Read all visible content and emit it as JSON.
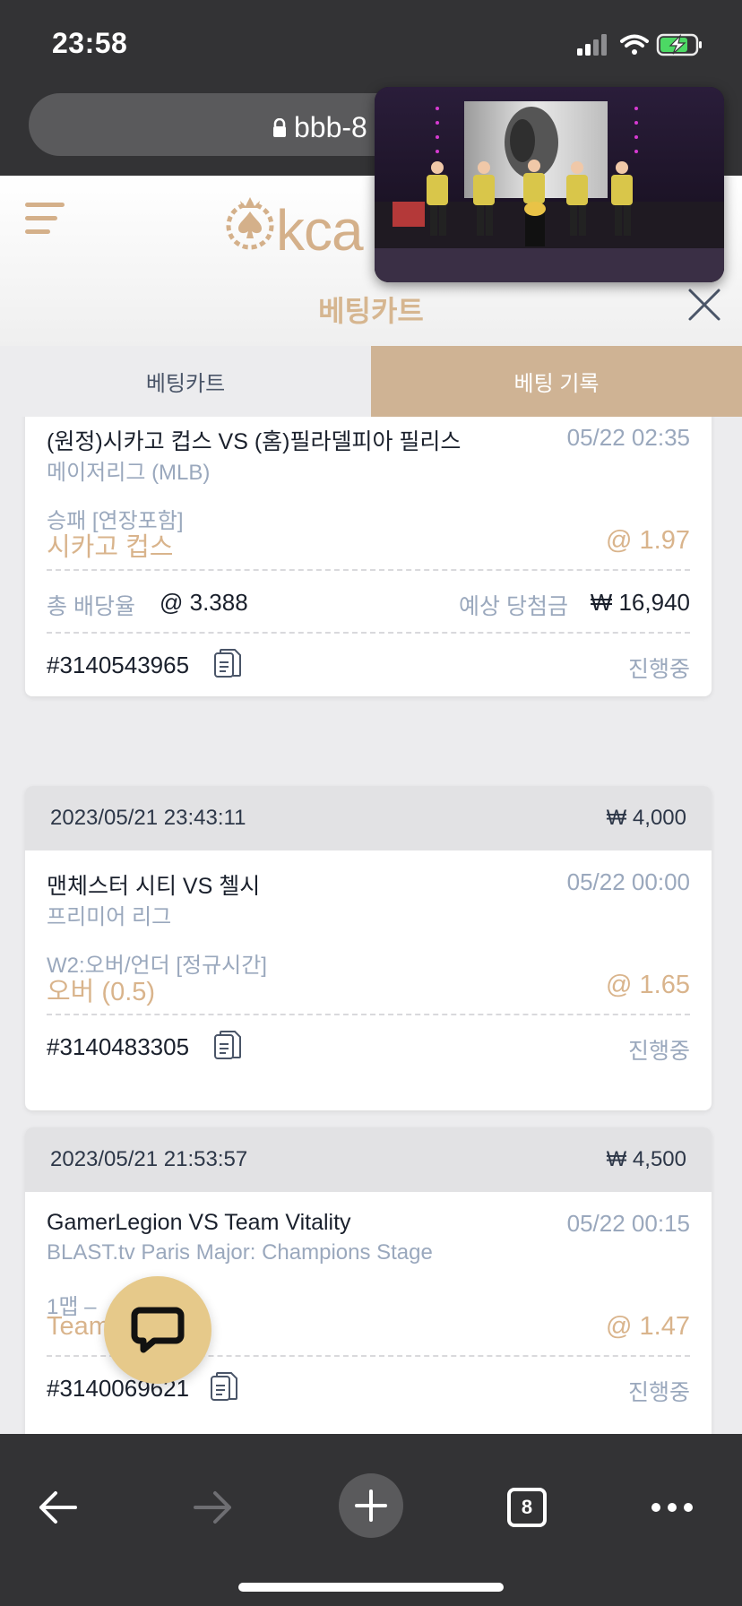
{
  "status_bar": {
    "time": "23:58"
  },
  "browser": {
    "url": "bbb-8"
  },
  "header": {
    "logo_text": "kca",
    "title": "베팅카트"
  },
  "tabs": [
    {
      "label": "베팅카트",
      "active": false
    },
    {
      "label": "베팅 기록",
      "active": true
    }
  ],
  "bets": [
    {
      "match": "(원정)시카고 컵스 VS (홈)필라델피아 필리스",
      "time": "05/22 02:35",
      "league": "메이저리그 (MLB)",
      "market": "승패 [연장포함]",
      "pick": "시카고 컵스",
      "odds": "@ 1.97",
      "total_label": "총 배당율",
      "total_odds": "@ 3.388",
      "win_label": "예상 당첨금",
      "win_amount": "₩ 16,940",
      "id": "#3140543965",
      "status": "진행중"
    },
    {
      "datetime": "2023/05/21 23:43:11",
      "amount": "₩ 4,000",
      "match": "맨체스터 시티 VS 첼시",
      "time": "05/22 00:00",
      "league": "프리미어 리그",
      "market": "W2:오버/언더 [정규시간]",
      "pick": "오버 (0.5)",
      "odds": "@ 1.65",
      "id": "#3140483305",
      "status": "진행중"
    },
    {
      "datetime": "2023/05/21 21:53:57",
      "amount": "₩ 4,500",
      "match": "GamerLegion VS Team Vitality",
      "time": "05/22 00:15",
      "league": "BLAST.tv Paris Major: Champions Stage",
      "market": "1맵 –",
      "pick": "Team Vitality",
      "odds": "@ 1.47",
      "id": "#3140069621",
      "status": "진행중"
    }
  ],
  "toolbar": {
    "tab_count": "8"
  },
  "colors": {
    "accent": "#d4b08a",
    "dark_bar": "#333335",
    "muted_text": "#9aa8bd"
  }
}
